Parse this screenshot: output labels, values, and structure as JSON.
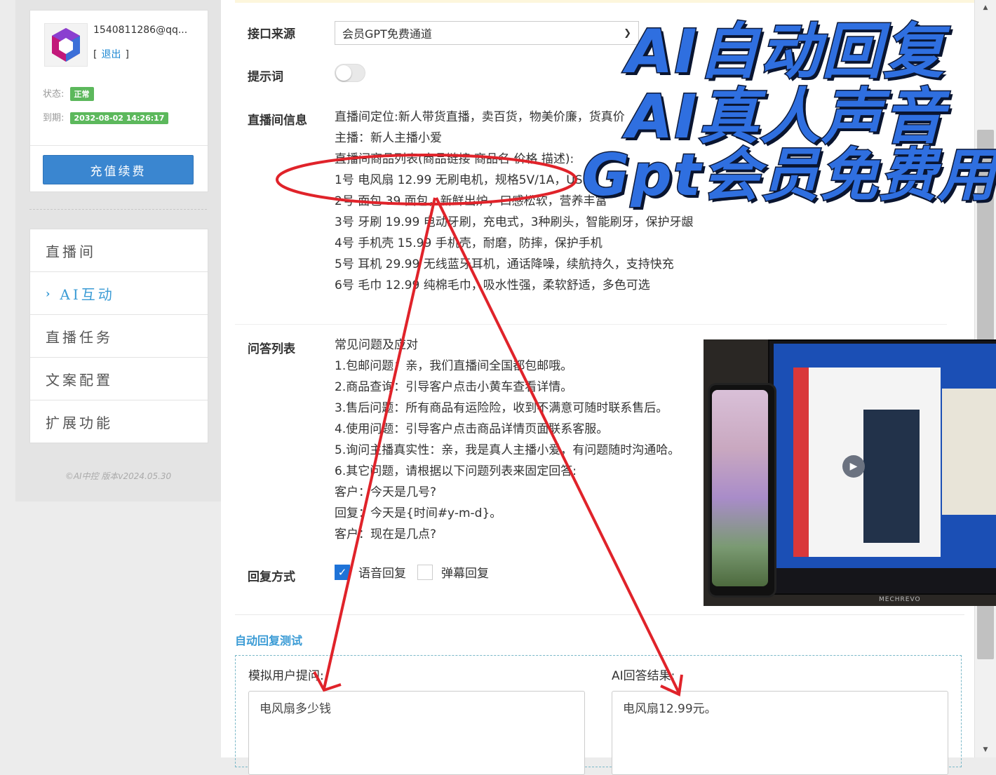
{
  "sidebar": {
    "account": "1540811286@qq...",
    "logout_bracket_open": "[",
    "logout_label": "退出",
    "logout_bracket_close": "]",
    "status_label": "状态:",
    "status_value": "正常",
    "expire_label": "到期:",
    "expire_value": "2032-08-02 14:26:17",
    "recharge_button": "充值续费",
    "nav": [
      {
        "label": "直播间",
        "active": false
      },
      {
        "label": "AI互动",
        "active": true
      },
      {
        "label": "直播任务",
        "active": false
      },
      {
        "label": "文案配置",
        "active": false
      },
      {
        "label": "扩展功能",
        "active": false
      }
    ],
    "version": "©AI中控 版本v2024.05.30"
  },
  "main": {
    "api_source_label": "接口来源",
    "api_source_value": "会员GPT免费通道",
    "prompt_label": "提示词",
    "prompt_enabled": false,
    "room_info_label": "直播间信息",
    "room_info_lines": [
      "直播间定位:新人带货直播，卖百货，物美价廉，货真价",
      "主播：新人主播小爱",
      "直播间商品列表(商品链接 商品名 价格 描述):",
      "1号 电风扇 12.99 无刷电机，规格5V/1A，USB",
      "2号 面包 39 面包，新鲜出炉，口感松软，营养丰富",
      "3号 牙刷 19.99 电动牙刷，充电式，3种刷头，智能刷牙，保护牙龈",
      "4号 手机壳 15.99 手机壳，耐磨，防摔，保护手机",
      "5号 耳机 29.99 无线蓝牙耳机，通话降噪，续航持久，支持快充",
      "6号 毛巾 12.99 纯棉毛巾，吸水性强，柔软舒适，多色可选"
    ],
    "qa_label": "问答列表",
    "qa_lines": [
      "常见问题及应对",
      "1.包邮问题：亲，我们直播间全国都包邮哦。",
      "2.商品查询：引导客户点击小黄车查看详情。",
      "3.售后问题：所有商品有运险险，收到不满意可随时联系售后。",
      "4.使用问题：引导客户点击商品详情页面联系客服。",
      "5.询问主播真实性：亲，我是真人主播小爱，有问题随时沟通哈。",
      "6.其它问题，请根据以下问题列表来固定回答:",
      "客户：今天是几号?",
      "回复：今天是{时间#y-m-d}。",
      "客户：现在是几点?"
    ],
    "reply_mode_label": "回复方式",
    "reply_voice_label": "语音回复",
    "reply_voice_checked": true,
    "reply_danmu_label": "弹幕回复",
    "reply_danmu_checked": false,
    "test_title": "自动回复测试",
    "user_question_label": "模拟用户提问:",
    "user_question_value": "电风扇多少钱",
    "ai_answer_label": "AI回答结果:",
    "ai_answer_value": "电风扇12.99元。"
  },
  "overlay": {
    "promo_line_1": "AI自动回复",
    "promo_line_2": "AI真人声音",
    "promo_line_3": "Gpt会员免费用",
    "promo_color": "#2f6fe0",
    "annotation_color": "#e0232a",
    "photo_brand": "MECHREVO"
  },
  "colors": {
    "accent": "#3a9bd5",
    "button": "#3a86d0",
    "badge_green": "#5cb85c",
    "checkbox_blue": "#1e73d8"
  }
}
